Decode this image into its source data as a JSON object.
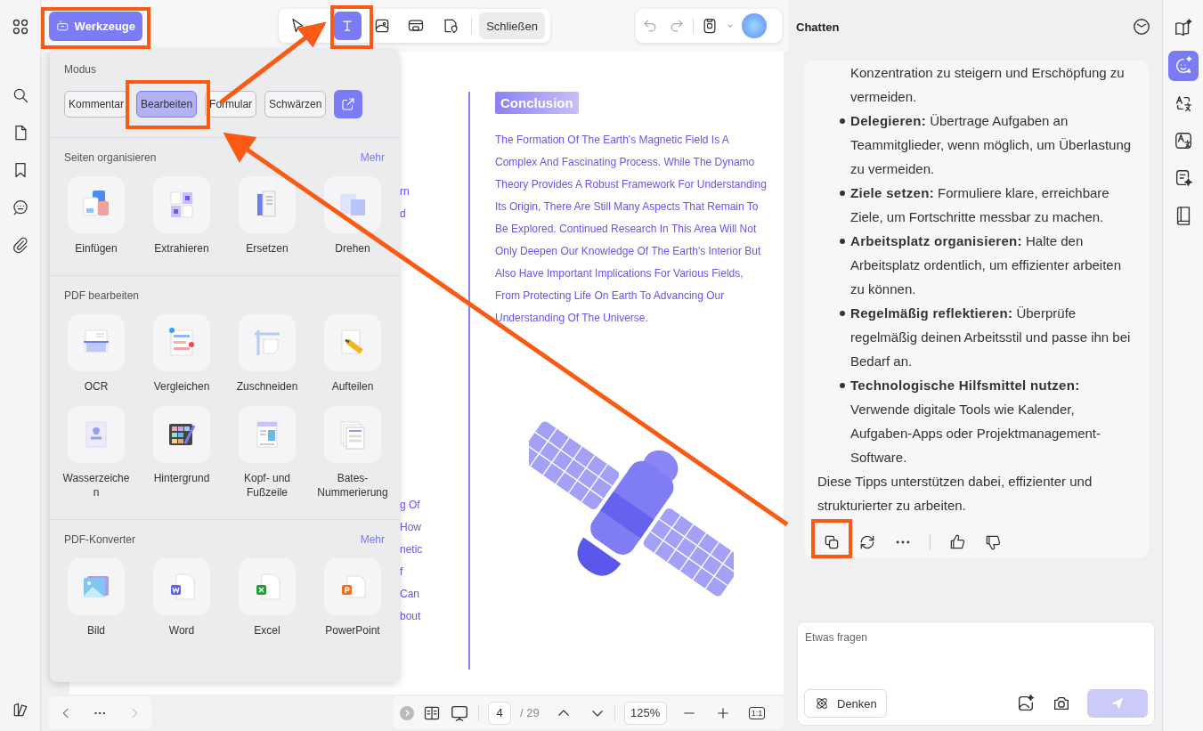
{
  "toolbar": {
    "tools_button": "Werkzeuge",
    "edit_tools": [
      {
        "selected": false
      },
      {
        "selected": true
      },
      {
        "selected": false
      },
      {
        "selected": false
      },
      {
        "selected": false
      }
    ],
    "close_button": "Schließen"
  },
  "tools_panel": {
    "mode_title": "Modus",
    "modes": [
      {
        "label": "Kommentar",
        "selected": false
      },
      {
        "label": "Bearbeiten",
        "selected": true
      },
      {
        "label": "Formular",
        "selected": false
      },
      {
        "label": "Schwärzen",
        "selected": false
      }
    ],
    "sections": [
      {
        "title": "Seiten organisieren",
        "more": "Mehr",
        "tools": [
          "Einfügen",
          "Extrahieren",
          "Ersetzen",
          "Drehen"
        ]
      },
      {
        "title": "PDF bearbeiten",
        "tools": [
          "OCR",
          "Vergleichen",
          "Zuschneiden",
          "Aufteilen",
          "Wasserzeichen",
          "Hintergrund",
          "Kopf- und Fußzeile",
          "Bates-Nummerierung"
        ]
      },
      {
        "title": "PDF-Konverter",
        "more": "Mehr",
        "tools": [
          "Bild",
          "Word",
          "Excel",
          "PowerPoint"
        ]
      }
    ]
  },
  "document": {
    "fragments": [
      [
        "rn",
        "d"
      ],
      [
        "g Of",
        "How",
        "netic",
        "f",
        "Can",
        "bout"
      ]
    ],
    "heading": "Conclusion",
    "paragraph_lines": [
      "The Formation Of The Earth's Magnetic Field Is A",
      "Complex And Fascinating Process. While The Dynamo",
      "Theory Provides A Robust Framework For Understanding",
      "Its Origin, There Are Still Many Aspects That Remain To",
      "Be Explored. Continued Research In This Area Will Not",
      "Only Deepen Our Knowledge Of The Earth's Interior But",
      "Also Have Important Implications For Various Fields,",
      "From Protecting Life On Earth To Advancing Our",
      "Understanding Of The Universe."
    ]
  },
  "bottom_bar": {
    "page": "4",
    "page_count": "/ 29",
    "zoom": "125%",
    "fit": "1:1"
  },
  "chat": {
    "title": "Chatten",
    "items": [
      {
        "kind": "continuation",
        "text": "Konzentration zu steigern und Erschöpfung zu vermeiden."
      },
      {
        "kind": "bullet",
        "text": "**Delegieren:** Übertrage Aufgaben an Teammitglieder, wenn möglich, um Überlastung zu vermeiden."
      },
      {
        "kind": "bullet",
        "text": "**Ziele setzen:** Formuliere klare, erreichbare Ziele, um Fortschritte messbar zu machen."
      },
      {
        "kind": "bullet",
        "text": "**Arbeitsplatz organisieren:** Halte den Arbeitsplatz ordentlich, um effizienter arbeiten zu können."
      },
      {
        "kind": "bullet",
        "text": "**Regelmäßig reflektieren:** Überprüfe regelmäßig deinen Arbeitsstil und passe ihn bei Bedarf an."
      },
      {
        "kind": "bullet",
        "text": "**Technologische Hilfsmittel nutzen:** Verwende digitale Tools wie Kalender, Aufgaben-Apps oder Projektmanagement-Software."
      }
    ],
    "closing": "Diese Tipps unterstützen dabei, effizienter und strukturierter zu arbeiten.",
    "placeholder": "Etwas fragen",
    "think_button": "Denken"
  },
  "right_rail": {
    "items": [
      {
        "selected": false
      },
      {
        "selected": true
      },
      {
        "selected": false
      },
      {
        "selected": false
      },
      {
        "selected": false
      },
      {
        "selected": false
      }
    ]
  }
}
